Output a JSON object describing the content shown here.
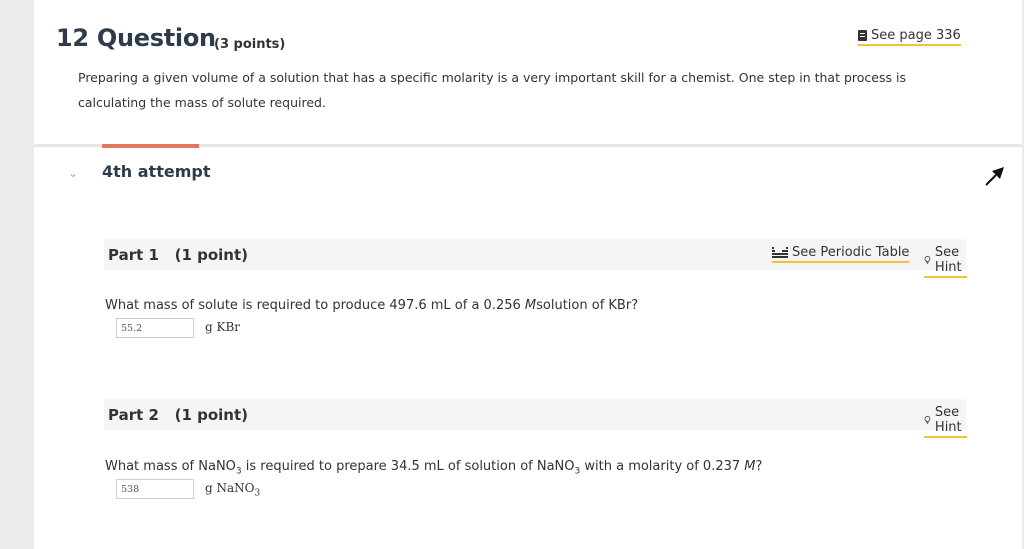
{
  "question": {
    "number": "12",
    "title": "Question",
    "points": "(3 points)",
    "see_page": "See page 336",
    "intro": "Preparing a given volume of a solution that has a specific molarity is a very important skill for a chemist. One step in that process is calculating the mass of solute required."
  },
  "attempt": {
    "label": "4th attempt"
  },
  "parts": [
    {
      "title": "Part 1   (1 point)",
      "periodic_table_link": "See Periodic Table",
      "hint_link": "See Hint",
      "question_prefix": "What mass of solute is required to produce 497.6 mL of a 0.256 ",
      "question_unit": "M",
      "question_suffix": "solution of KBr?",
      "answer_value": "55.2",
      "unit": "g KBr"
    },
    {
      "title": "Part 2   (1 point)",
      "hint_link": "See Hint",
      "question_a": "What mass of NaNO",
      "sub_a": "3",
      "question_b": " is required to prepare 34.5 mL of solution of NaNO",
      "sub_b": "3",
      "question_c": " with a molarity of 0.237 ",
      "question_unit": "M",
      "question_end": "?",
      "answer_value": "538",
      "unit_prefix": "g NaNO",
      "unit_sub": "3"
    }
  ],
  "colors": {
    "accent_underline": "#f0c23c",
    "attempt_bar": "#e07a5f",
    "heading": "#2e3b4a"
  }
}
